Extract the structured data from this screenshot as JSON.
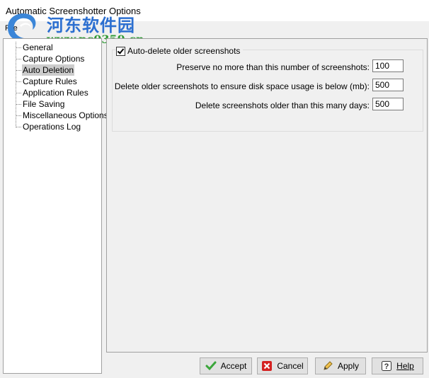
{
  "window": {
    "title": "Automatic Screenshotter Options"
  },
  "menu": {
    "file": "File"
  },
  "watermark": {
    "name": "河东软件园",
    "url": "www.pc0359.cn"
  },
  "tree": {
    "items": [
      {
        "label": "General",
        "selected": false
      },
      {
        "label": "Capture Options",
        "selected": false
      },
      {
        "label": "Auto Deletion",
        "selected": true
      },
      {
        "label": "Capture Rules",
        "selected": false
      },
      {
        "label": "Application Rules",
        "selected": false
      },
      {
        "label": "File Saving",
        "selected": false
      },
      {
        "label": "Miscellaneous Options",
        "selected": false
      },
      {
        "label": "Operations Log",
        "selected": false
      }
    ]
  },
  "auto_deletion": {
    "checkbox_label": "Auto-delete older screenshots",
    "checked": true,
    "rows": [
      {
        "label": "Preserve no more than this number of screenshots:",
        "value": "100"
      },
      {
        "label": "Delete older screenshots to ensure disk space usage is below (mb):",
        "value": "500"
      },
      {
        "label": "Delete screenshots older than this many days:",
        "value": "500"
      }
    ]
  },
  "buttons": {
    "accept": "Accept",
    "cancel": "Cancel",
    "apply": "Apply",
    "help": "Help"
  },
  "colors": {
    "selection": "#cccccc",
    "accept_icon": "#3aa63a",
    "cancel_icon": "#d42020"
  }
}
